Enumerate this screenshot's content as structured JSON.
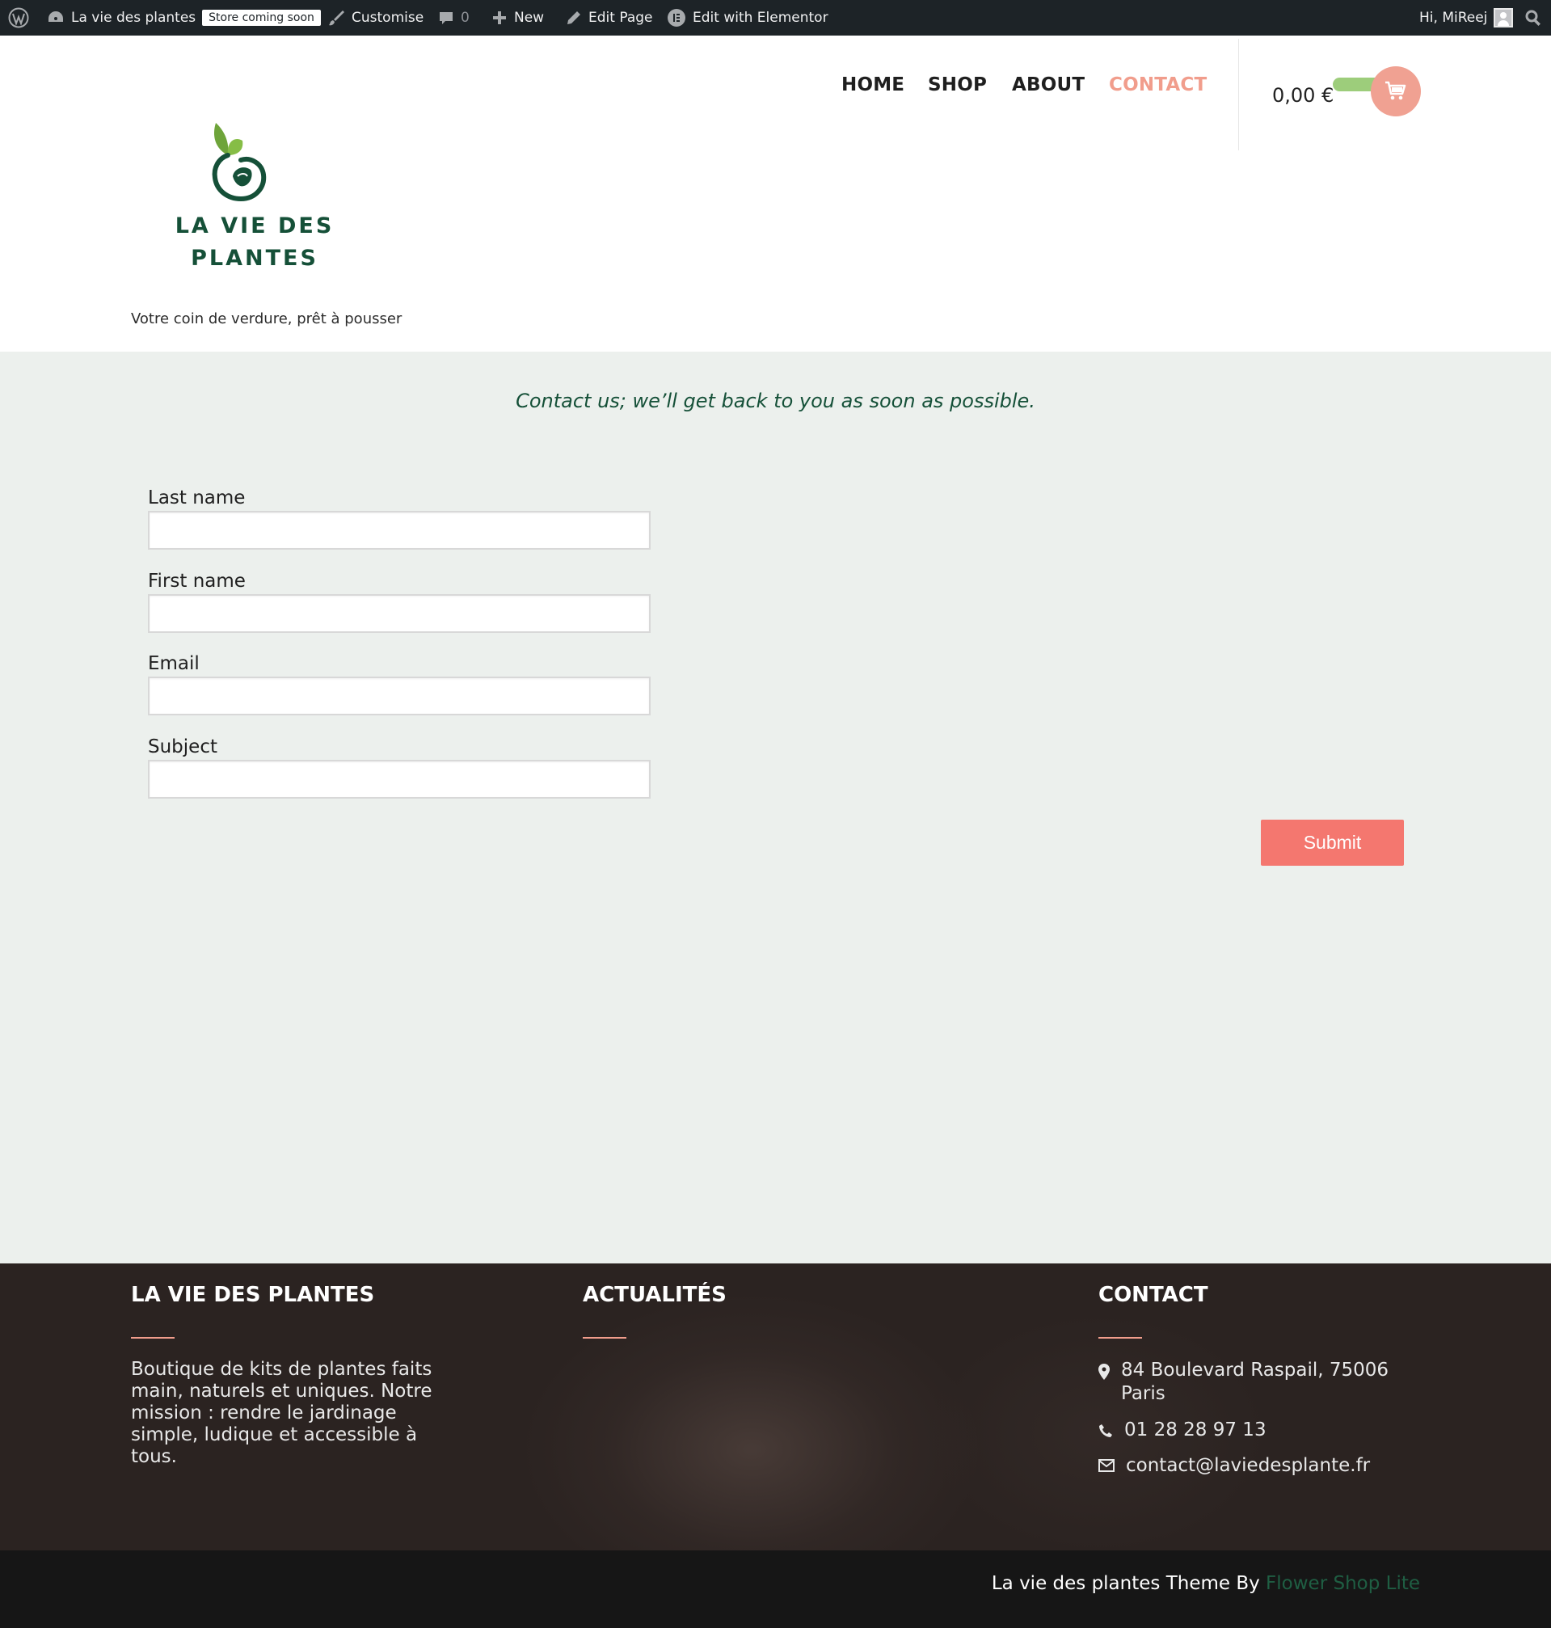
{
  "admin_bar": {
    "site_name": "La vie des plantes",
    "status_badge": "Store coming soon",
    "customise": "Customise",
    "comments_count": "0",
    "new": "New",
    "edit_page": "Edit Page",
    "edit_elementor": "Edit with Elementor",
    "greeting": "Hi, MiReej"
  },
  "header": {
    "nav": [
      "HOME",
      "SHOP",
      "ABOUT",
      "CONTACT"
    ],
    "active_nav": "CONTACT",
    "cart_total": "0,00 €",
    "logo_line1": "LA VIE DES",
    "logo_line2": "PLANTES",
    "tagline": "Votre coin de verdure, prêt à pousser"
  },
  "content": {
    "intro": "Contact us; we’ll get back to you as soon as possible.",
    "fields": [
      {
        "label": "Last name",
        "value": ""
      },
      {
        "label": "First name",
        "value": ""
      },
      {
        "label": "Email",
        "value": ""
      },
      {
        "label": "Subject",
        "value": ""
      }
    ],
    "submit": "Submit"
  },
  "footer": {
    "col1_title": "LA VIE DES PLANTES",
    "col1_text": "Boutique de kits de plantes faits main, naturels et uniques. Notre mission : rendre le jardinage simple, ludique et accessible à tous.",
    "col2_title": "ACTUALITÉS",
    "col3_title": "CONTACT",
    "address": "84 Boulevard Raspail, 75006 Paris",
    "phone": "01 28 28 97 13",
    "email": "contact@laviedesplante.fr",
    "credit_prefix": "La vie des plantes Theme By",
    "credit_link": "Flower Shop Lite"
  },
  "colors": {
    "admin_bar": "#1d2327",
    "accent_salmon": "#f19d8c",
    "submit_button": "#f4776f",
    "brand_green": "#155038",
    "cart_bar_green": "#9dcd7b",
    "page_background": "#ecf0ed"
  }
}
